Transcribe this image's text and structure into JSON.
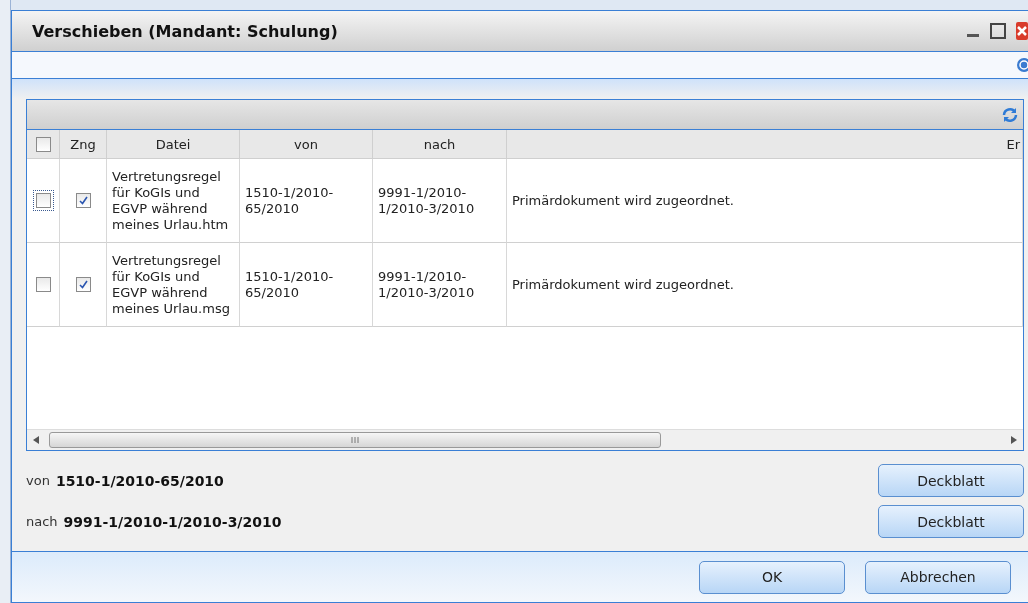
{
  "window": {
    "title": "Verschieben (Mandant: Schulung)"
  },
  "table": {
    "columns": [
      {
        "label": "Zng"
      },
      {
        "label": "Datei"
      },
      {
        "label": "von"
      },
      {
        "label": "nach"
      },
      {
        "label": "Er"
      }
    ],
    "header_checked": false,
    "rows": [
      {
        "checked": false,
        "focused": true,
        "zng": true,
        "datei": "Vertretungsregel\nfür KoGIs und\nEGVP während\nmeines Urlau.htm",
        "von": "1510-1/2010-\n65/2010",
        "nach": "9991-1/2010-\n1/2010-3/2010",
        "info": "Primärdokument wird zugeordnet."
      },
      {
        "checked": false,
        "focused": false,
        "zng": true,
        "datei": "Vertretungsregel\nfür KoGIs und\nEGVP während\nmeines Urlau.msg",
        "von": "1510-1/2010-\n65/2010",
        "nach": "9991-1/2010-\n1/2010-3/2010",
        "info": "Primärdokument wird zugeordnet."
      }
    ]
  },
  "details": [
    {
      "label": "von",
      "value": "1510-1/2010-65/2010",
      "button": "Deckblatt"
    },
    {
      "label": "nach",
      "value": "9991-1/2010-1/2010-3/2010",
      "button": "Deckblatt"
    }
  ],
  "buttons": [
    "OK",
    "Abbrechen"
  ]
}
